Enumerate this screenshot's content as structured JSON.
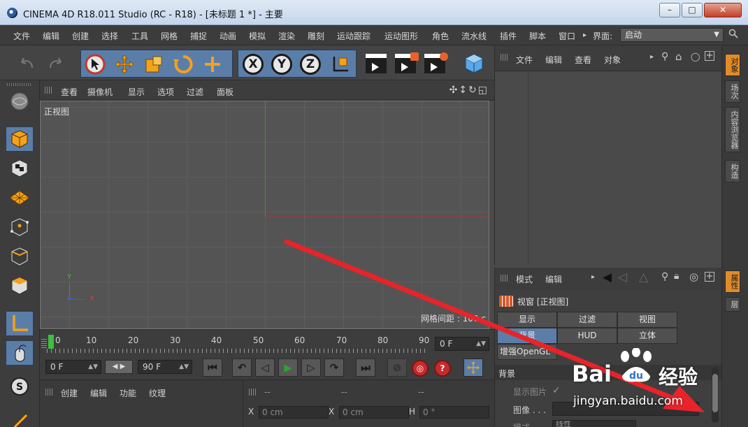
{
  "window": {
    "title": "CINEMA 4D R18.011 Studio (RC - R18) - [未标题 1 *] - 主要",
    "minimize_glyph": "–",
    "maximize_glyph": "□",
    "close_glyph": "✕"
  },
  "menubar": {
    "items": [
      "文件",
      "编辑",
      "创建",
      "选择",
      "工具",
      "网格",
      "捕捉",
      "动画",
      "模拟",
      "渲染",
      "雕刻",
      "运动跟踪",
      "运动图形",
      "角色",
      "流水线",
      "插件",
      "脚本",
      "窗口"
    ],
    "layout_label": "界面:",
    "layout_value": "启动",
    "arrow": "▸"
  },
  "toolbar": {
    "axis_x": "X",
    "axis_y": "Y",
    "axis_z": "Z"
  },
  "viewport": {
    "menu": [
      "查看",
      "摄像机",
      "显示",
      "选项",
      "过滤",
      "面板"
    ],
    "view_name": "正视图",
    "grid_spacing": "网格间距 : 100 c",
    "axis_y": "Y",
    "axis_x": "X"
  },
  "timeline": {
    "ticks": [
      "0",
      "10",
      "20",
      "30",
      "40",
      "50",
      "60",
      "70",
      "80",
      "90"
    ],
    "current_frame": "0 F"
  },
  "transport": {
    "start_frame": "0 F",
    "end_frame": "90 F"
  },
  "material_manager": {
    "menu": [
      "创建",
      "编辑",
      "功能",
      "纹理"
    ]
  },
  "coordinates": {
    "header_dashes": [
      "--",
      "--",
      "--"
    ],
    "row1": [
      {
        "label": "X",
        "value": "0 cm"
      },
      {
        "label": "X",
        "value": "0 cm"
      },
      {
        "label": "H",
        "value": "0 °"
      }
    ]
  },
  "object_manager": {
    "menu": [
      "文件",
      "编辑",
      "查看",
      "对象"
    ]
  },
  "attributes": {
    "menu": [
      "模式",
      "编辑"
    ],
    "title": "视窗 [正视图]",
    "tabs_row1": [
      "显示",
      "过滤",
      "视图"
    ],
    "tabs_row2": [
      "背景",
      "HUD",
      "立体"
    ],
    "tabs_row3": [
      "增强OpenGL"
    ],
    "section": "背景",
    "show_image_label": "显示图片",
    "show_image_check": "✓",
    "image_label": "图像 . . .",
    "mode_label": "模式",
    "mode_value": "线性"
  },
  "side_tabs": {
    "upper": [
      "对象",
      "场次",
      "内容浏览器",
      "构造"
    ],
    "lower": [
      "属性",
      "层"
    ]
  },
  "watermark": {
    "brand": "Bai",
    "brand2": "经验",
    "url": "jingyan.baidu.com"
  },
  "colors": {
    "accent_blue": "#5b7ea8",
    "accent_orange": "#e08a2a",
    "annotation_red": "#e8232a"
  }
}
